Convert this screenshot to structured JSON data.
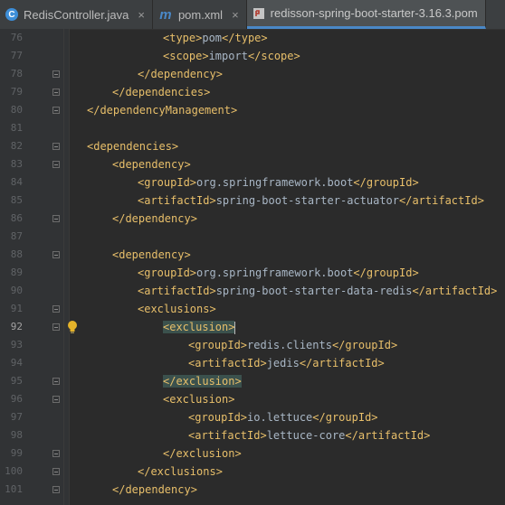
{
  "tabs": [
    {
      "icon": "class-icon",
      "label": "RedisController.java",
      "close": "×",
      "active": false
    },
    {
      "icon": "maven-icon",
      "label": "pom.xml",
      "close": "×",
      "active": false
    },
    {
      "icon": "pom-file-icon",
      "label": "redisson-spring-boot-starter-3.16.3.pom",
      "close": "",
      "active": true
    }
  ],
  "editor": {
    "current_line": 92,
    "lines": [
      {
        "num": "76",
        "indent": 6,
        "parts": [
          [
            "t",
            "<type>"
          ],
          [
            "x",
            "pom"
          ],
          [
            "t",
            "</type>"
          ]
        ]
      },
      {
        "num": "77",
        "indent": 6,
        "parts": [
          [
            "t",
            "<scope>"
          ],
          [
            "x",
            "import"
          ],
          [
            "t",
            "</scope>"
          ]
        ]
      },
      {
        "num": "78",
        "indent": 5,
        "parts": [
          [
            "t",
            "</dependency>"
          ]
        ],
        "fold": true
      },
      {
        "num": "79",
        "indent": 4,
        "parts": [
          [
            "t",
            "</dependencies>"
          ]
        ],
        "fold": true
      },
      {
        "num": "80",
        "indent": 3,
        "parts": [
          [
            "t",
            "</dependencyManagement>"
          ]
        ],
        "fold": true
      },
      {
        "num": "81",
        "indent": 0,
        "parts": []
      },
      {
        "num": "82",
        "indent": 3,
        "parts": [
          [
            "t",
            "<dependencies>"
          ]
        ],
        "fold": true
      },
      {
        "num": "83",
        "indent": 4,
        "parts": [
          [
            "t",
            "<dependency>"
          ]
        ],
        "fold": true
      },
      {
        "num": "84",
        "indent": 5,
        "parts": [
          [
            "t",
            "<groupId>"
          ],
          [
            "x",
            "org.springframework.boot"
          ],
          [
            "t",
            "</groupId>"
          ]
        ]
      },
      {
        "num": "85",
        "indent": 5,
        "parts": [
          [
            "t",
            "<artifactId>"
          ],
          [
            "x",
            "spring-boot-starter-actuator"
          ],
          [
            "t",
            "</artifactId>"
          ]
        ]
      },
      {
        "num": "86",
        "indent": 4,
        "parts": [
          [
            "t",
            "</dependency>"
          ]
        ],
        "fold": true
      },
      {
        "num": "87",
        "indent": 0,
        "parts": []
      },
      {
        "num": "88",
        "indent": 4,
        "parts": [
          [
            "t",
            "<dependency>"
          ]
        ],
        "fold": true
      },
      {
        "num": "89",
        "indent": 5,
        "parts": [
          [
            "t",
            "<groupId>"
          ],
          [
            "x",
            "org.springframework.boot"
          ],
          [
            "t",
            "</groupId>"
          ]
        ]
      },
      {
        "num": "90",
        "indent": 5,
        "parts": [
          [
            "t",
            "<artifactId>"
          ],
          [
            "x",
            "spring-boot-starter-data-redis"
          ],
          [
            "t",
            "</artifactId>"
          ]
        ]
      },
      {
        "num": "91",
        "indent": 5,
        "parts": [
          [
            "t",
            "<exclusions>"
          ]
        ],
        "fold": true
      },
      {
        "num": "92",
        "indent": 6,
        "parts": [
          [
            "h",
            "<exclusion>"
          ],
          [
            "c",
            ""
          ]
        ],
        "fold": true,
        "bulb": true
      },
      {
        "num": "93",
        "indent": 7,
        "parts": [
          [
            "t",
            "<groupId>"
          ],
          [
            "x",
            "redis.clients"
          ],
          [
            "t",
            "</groupId>"
          ]
        ]
      },
      {
        "num": "94",
        "indent": 7,
        "parts": [
          [
            "t",
            "<artifactId>"
          ],
          [
            "x",
            "jedis"
          ],
          [
            "t",
            "</artifactId>"
          ]
        ]
      },
      {
        "num": "95",
        "indent": 6,
        "parts": [
          [
            "h",
            "</exclusion>"
          ]
        ],
        "fold": true
      },
      {
        "num": "96",
        "indent": 6,
        "parts": [
          [
            "t",
            "<exclusion>"
          ]
        ],
        "fold": true
      },
      {
        "num": "97",
        "indent": 7,
        "parts": [
          [
            "t",
            "<groupId>"
          ],
          [
            "x",
            "io.lettuce"
          ],
          [
            "t",
            "</groupId>"
          ]
        ]
      },
      {
        "num": "98",
        "indent": 7,
        "parts": [
          [
            "t",
            "<artifactId>"
          ],
          [
            "x",
            "lettuce-core"
          ],
          [
            "t",
            "</artifactId>"
          ]
        ]
      },
      {
        "num": "99",
        "indent": 6,
        "parts": [
          [
            "t",
            "</exclusion>"
          ]
        ],
        "fold": true
      },
      {
        "num": "100",
        "indent": 5,
        "parts": [
          [
            "t",
            "</exclusions>"
          ]
        ],
        "fold": true
      },
      {
        "num": "101",
        "indent": 4,
        "parts": [
          [
            "t",
            "</dependency>"
          ]
        ],
        "fold": true
      }
    ]
  },
  "colors": {
    "background": "#2b2b2b",
    "tag": "#e8bf6a",
    "text": "#a9b7c6",
    "highlight": "#3b514d",
    "gutter": "#313335"
  }
}
